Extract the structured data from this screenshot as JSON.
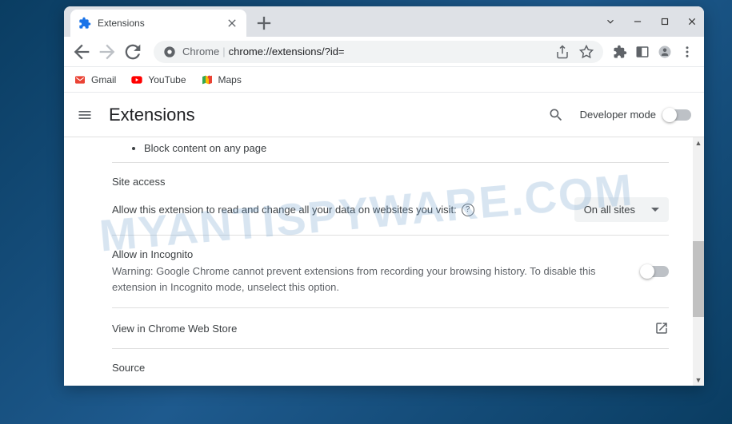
{
  "watermark": "MYANTISPYWARE.COM",
  "tab": {
    "title": "Extensions"
  },
  "omnibox": {
    "prefix": "Chrome",
    "url": "chrome://extensions/?id="
  },
  "bookmarks": [
    {
      "label": "Gmail",
      "icon": "gmail"
    },
    {
      "label": "YouTube",
      "icon": "youtube"
    },
    {
      "label": "Maps",
      "icon": "maps"
    }
  ],
  "header": {
    "title": "Extensions",
    "dev_mode_label": "Developer mode"
  },
  "content": {
    "bullet_item": "Block content on any page",
    "site_access": {
      "title": "Site access",
      "description": "Allow this extension to read and change all your data on websites you visit:",
      "dropdown_value": "On all sites"
    },
    "incognito": {
      "title": "Allow in Incognito",
      "warning": "Warning: Google Chrome cannot prevent extensions from recording your browsing history. To disable this extension in Incognito mode, unselect this option."
    },
    "web_store": {
      "label": "View in Chrome Web Store"
    },
    "source": {
      "title": "Source"
    }
  }
}
